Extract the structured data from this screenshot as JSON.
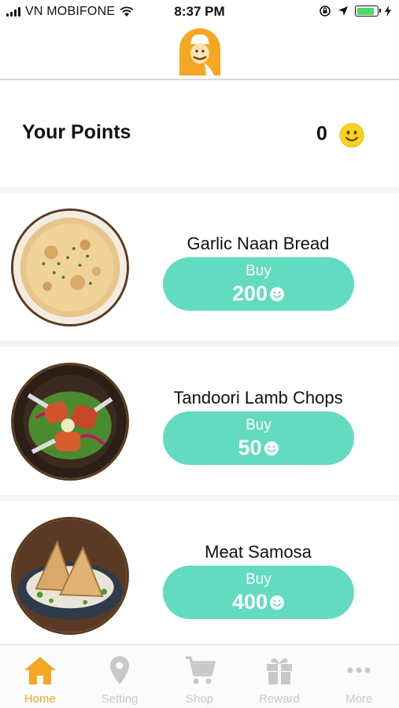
{
  "status_bar": {
    "carrier": "VN MOBIFONE",
    "time": "8:37 PM",
    "battery_level": 0.85
  },
  "header": {
    "logo_icon": "chef-mascot-logo"
  },
  "points": {
    "title": "Your Points",
    "value": "0",
    "icon": "smiley-icon"
  },
  "rewards": [
    {
      "name": "Garlic Naan Bread",
      "buy_label": "Buy",
      "price": "200",
      "image": "garlic-naan-image"
    },
    {
      "name": "Tandoori Lamb Chops",
      "buy_label": "Buy",
      "price": "50",
      "image": "lamb-chops-image"
    },
    {
      "name": "Meat Samosa",
      "buy_label": "Buy",
      "price": "400",
      "image": "samosa-image"
    }
  ],
  "tab_bar": [
    {
      "label": "Home",
      "icon": "home-icon",
      "active": true
    },
    {
      "label": "Setting",
      "icon": "location-pin-icon",
      "active": false
    },
    {
      "label": "Shop",
      "icon": "cart-icon",
      "active": false
    },
    {
      "label": "Reward",
      "icon": "gift-icon",
      "active": false
    },
    {
      "label": "More",
      "icon": "more-dots-icon",
      "active": false
    }
  ],
  "colors": {
    "accent": "#63dbc0",
    "brand": "#f5a623",
    "tab_inactive": "#c8c8c8",
    "smiley": "#f8d21c"
  }
}
